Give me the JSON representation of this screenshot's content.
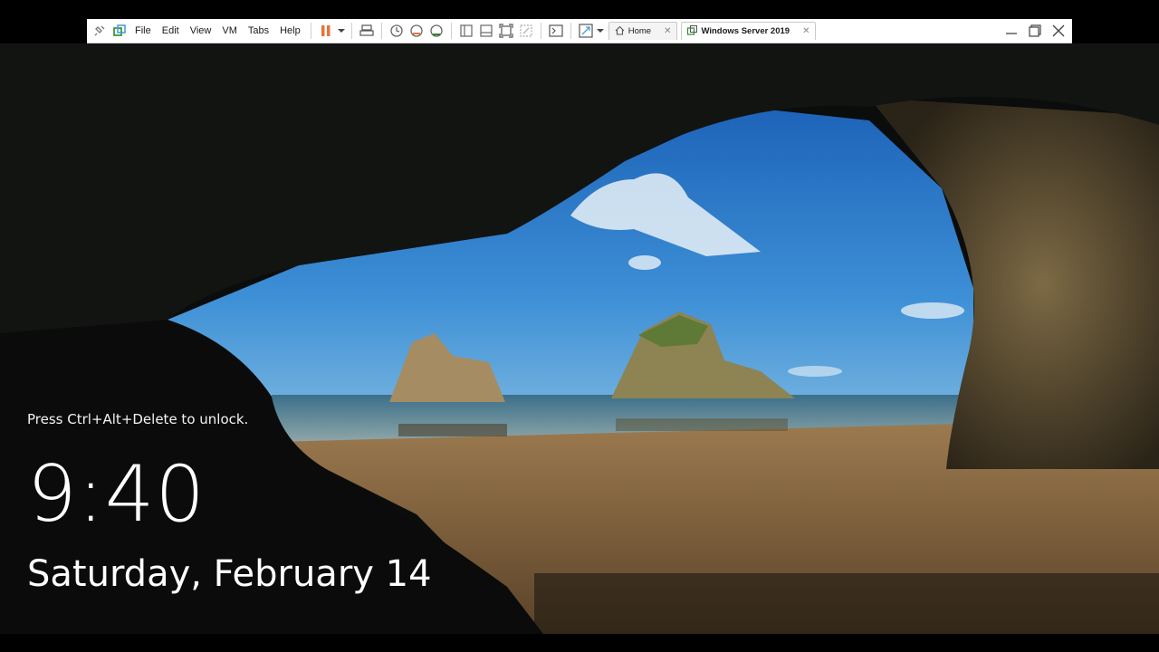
{
  "menu": {
    "file": "File",
    "edit": "Edit",
    "view": "View",
    "vm": "VM",
    "tabs": "Tabs",
    "help": "Help"
  },
  "tabs": [
    {
      "label": "Home",
      "icon": "home-icon",
      "active": false
    },
    {
      "label": "Windows Server 2019",
      "icon": "vm-icon",
      "active": true
    }
  ],
  "toolbar_icons": [
    "pin-icon",
    "library-icon",
    "pause-icon",
    "dropdown-icon",
    "send-keys-icon",
    "snapshot-icon",
    "revert-snapshot-icon",
    "snapshot-manager-icon",
    "show-library-icon",
    "thumbnail-bar-icon",
    "full-screen-icon",
    "unity-icon",
    "console-icon",
    "stretch-icon",
    "dropdown-icon"
  ],
  "lock_screen": {
    "unlock_prompt": "Press Ctrl+Alt+Delete to unlock.",
    "time": "9:40",
    "date": "Saturday, February 14"
  },
  "colors": {
    "pause": "#e8743b",
    "accent_green": "#3a9a3a",
    "sky": "#2e7fcc",
    "sand": "#8a6a45"
  }
}
